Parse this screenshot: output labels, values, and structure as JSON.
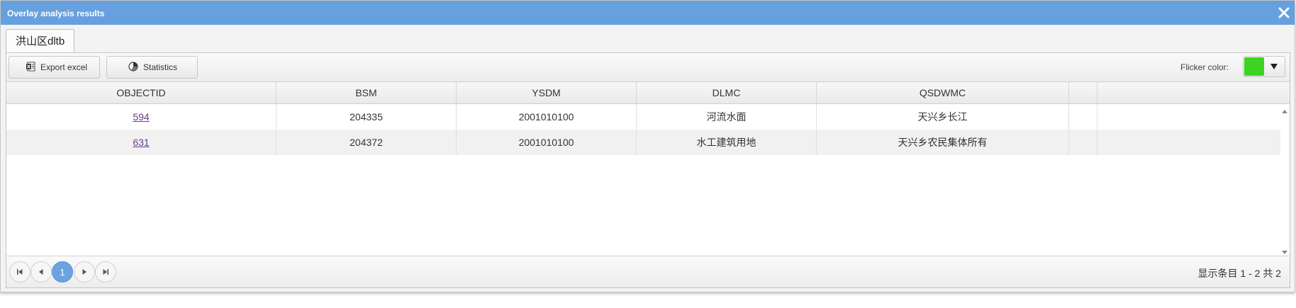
{
  "window": {
    "title": "Overlay analysis results"
  },
  "tabs": [
    {
      "label": "洪山区dltb"
    }
  ],
  "toolbar": {
    "export_label": "Export excel",
    "export_icon": "excel-icon",
    "statistics_label": "Statistics",
    "statistics_icon": "pie-chart-icon",
    "flicker_label": "Flicker color:",
    "flicker_color": "#3cd321"
  },
  "table": {
    "columns": [
      "OBJECTID",
      "BSM",
      "YSDM",
      "DLMC",
      "QSDWMC"
    ],
    "rows": [
      {
        "objectid": "594",
        "bsm": "204335",
        "ysdm": "2001010100",
        "dlmc": "河流水面",
        "qsdwmc": "天兴乡长江"
      },
      {
        "objectid": "631",
        "bsm": "204372",
        "ysdm": "2001010100",
        "dlmc": "水工建筑用地",
        "qsdwmc": "天兴乡农民集体所有"
      }
    ]
  },
  "pager": {
    "current_page": "1",
    "info": "显示条目 1 - 2 共 2"
  },
  "colors": {
    "titlebar": "#66a0de",
    "link": "#6d3a8f",
    "active_page": "#6aa3e0"
  }
}
